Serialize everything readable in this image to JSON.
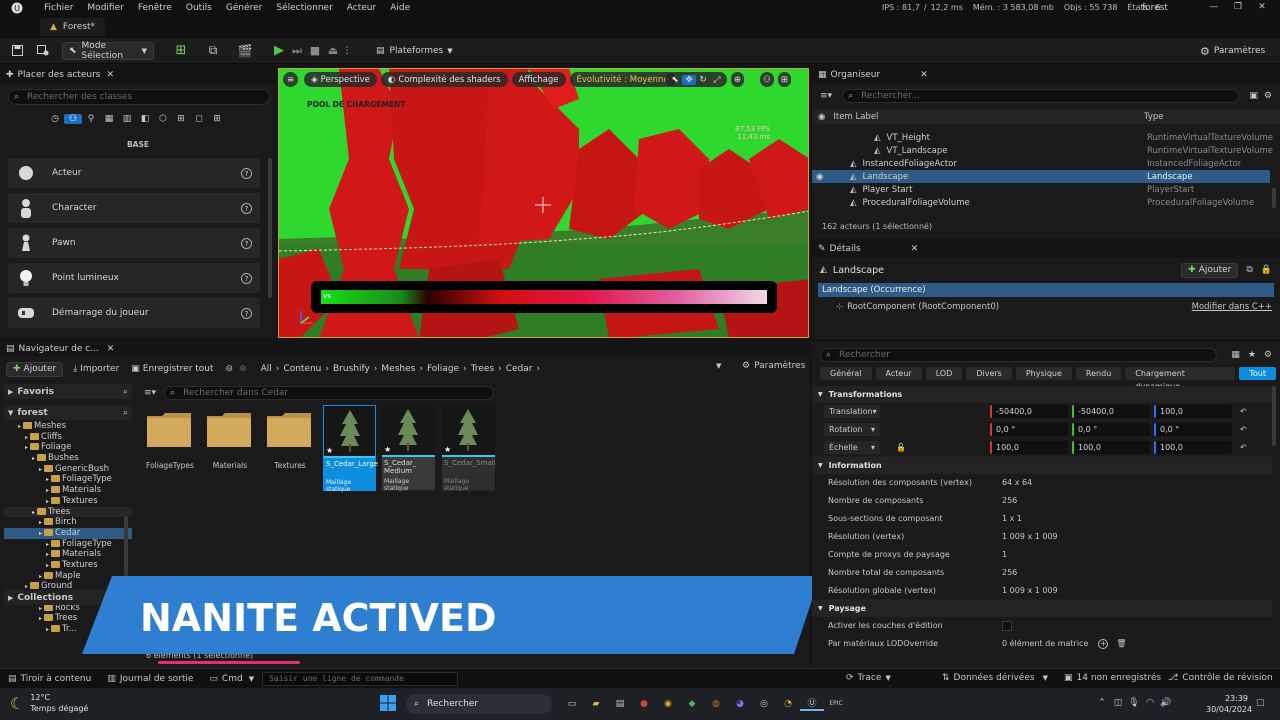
{
  "menu": [
    "Fichier",
    "Modifier",
    "Fenêtre",
    "Outils",
    "Générer",
    "Sélectionner",
    "Acteur",
    "Aide"
  ],
  "window_title": "forest",
  "stats": {
    "fps": "IPS : 81,7",
    "ms": "12,2 ms",
    "mem": "Mém. : 3 583,08 mb",
    "objs": "Objs : 55 738",
    "etats": "États : 6"
  },
  "level_tab": "Forest*",
  "toolbar": {
    "mode": "Mode Sélection",
    "platforms": "Plateformes",
    "settings": "Paramètres"
  },
  "place_actors": {
    "title": "Placer des acteurs",
    "search_placeholder": "Rechercher des classes",
    "category": "BASE",
    "items": [
      "Acteur",
      "Character",
      "Pawn",
      "Point lumineux",
      "Démarrage du joueur"
    ]
  },
  "viewport": {
    "perspective": "Perspective",
    "shader_complexity": "Complexité des shaders",
    "display": "Affichage",
    "scalability": "Évolutivité : Moyenne",
    "overlay_text": "POOL DE CHARGEMENT",
    "fps": "87,53 FPS",
    "ms": "11,43 ms",
    "bar_label": "vs"
  },
  "content_browser": {
    "tab": "Navigateur de c...",
    "add": "Ajouter",
    "import": "Importer",
    "save_all": "Enregistrer tout",
    "settings": "Paramètres",
    "breadcrumb": [
      "All",
      "Contenu",
      "Brushify",
      "Meshes",
      "Foliage",
      "Trees",
      "Cedar"
    ],
    "search_placeholder": "Rechercher dans Cedar",
    "favorites": "Favoris",
    "root": "forest",
    "collections": "Collections",
    "item_count": "6 éléments (1 sélectionné)",
    "tree": [
      {
        "label": "Meshes",
        "depth": 2
      },
      {
        "label": "Cliffs",
        "depth": 3
      },
      {
        "label": "Foliage",
        "depth": 3
      },
      {
        "label": "Bushes",
        "depth": 4
      },
      {
        "label": "GenericBush",
        "depth": 5
      },
      {
        "label": "FoliageType",
        "depth": 6
      },
      {
        "label": "Materials",
        "depth": 6
      },
      {
        "label": "Textures",
        "depth": 6
      },
      {
        "label": "Trees",
        "depth": 4
      },
      {
        "label": "Birch",
        "depth": 5
      },
      {
        "label": "Cedar",
        "depth": 5
      },
      {
        "label": "FoliageType",
        "depth": 6
      },
      {
        "label": "Materials",
        "depth": 6
      },
      {
        "label": "Textures",
        "depth": 6
      },
      {
        "label": "Maple",
        "depth": 5
      },
      {
        "label": "Ground",
        "depth": 3
      },
      {
        "label": "Forest",
        "depth": 4
      },
      {
        "label": "Rocks",
        "depth": 5
      },
      {
        "label": "Trees",
        "depth": 5
      },
      {
        "label": "Tr...",
        "depth": 6
      }
    ],
    "folders": [
      "FoliageTypes",
      "Materials",
      "Textures"
    ],
    "assets": [
      {
        "name": "S_Cedar_Large",
        "type": "Maillage statique"
      },
      {
        "name": "S_Cedar_ Medium",
        "type": "Maillage statique"
      },
      {
        "name": "S_Cedar_Small",
        "type": "Maillage statique"
      }
    ]
  },
  "outliner": {
    "title": "Organiseur",
    "search_placeholder": "Rechercher...",
    "col_label": "Item Label",
    "col_type": "Type",
    "rows": [
      {
        "label": "VT_Height",
        "type": "RuntimeVirtualTextureVolume"
      },
      {
        "label": "VT_Landscape",
        "type": "RuntimeVirtualTextureVolume"
      },
      {
        "label": "InstancedFoliageActor",
        "type": "InstancedFoliageActor"
      },
      {
        "label": "Landscape",
        "type": "Landscape"
      },
      {
        "label": "Player Start",
        "type": "PlayerStart"
      },
      {
        "label": "ProceduralFoliageVolume",
        "type": "ProceduralFoliageVolume"
      }
    ],
    "count": "162 acteurs (1 sélectionné)"
  },
  "details": {
    "title": "Détails",
    "object": "Landscape",
    "add": "Ajouter",
    "instance": "Landscape (Occurrence)",
    "root_component": "RootComponent (RootComponent0)",
    "edit_cpp": "Modifier dans C++",
    "search_placeholder": "Rechercher",
    "tabs": [
      "Général",
      "Acteur",
      "LOD",
      "Divers",
      "Physique",
      "Rendu",
      "Chargement dynamique",
      "Tout"
    ],
    "transforms_header": "Transformations",
    "transforms": [
      {
        "label": "Translation",
        "x": "-50400,0",
        "y": "-50400,0",
        "z": "100,0"
      },
      {
        "label": "Rotation",
        "x": "0,0 °",
        "y": "0,0 °",
        "z": "0,0 °"
      },
      {
        "label": "Échelle",
        "x": "100,0",
        "y": "100,0",
        "z": "100,0"
      }
    ],
    "info_header": "Information",
    "info": [
      {
        "label": "Résolution des composants (vertex)",
        "value": "64 x 64"
      },
      {
        "label": "Nombre de composants",
        "value": "256"
      },
      {
        "label": "Sous-sections de composant",
        "value": "1 x 1"
      },
      {
        "label": "Résolution (vertex)",
        "value": "1 009 x 1 009"
      },
      {
        "label": "Compte de proxys de paysage",
        "value": "1"
      },
      {
        "label": "Nombre total de composants",
        "value": "256"
      },
      {
        "label": "Résolution globale (vertex)",
        "value": "1 009 x 1 009"
      }
    ],
    "landscape_header": "Paysage",
    "landscape_rows": [
      {
        "label": "Activer les couches d'édition",
        "value": ""
      },
      {
        "label": "Par matériaux LODOverride",
        "value": "0 élément de matrice"
      }
    ]
  },
  "statusbar": {
    "drawer": "Tiroir à contenu",
    "log": "Journal de sortie",
    "cmd": "Cmd",
    "cmd_placeholder": "Saisir une ligne de commande",
    "trace": "Trace",
    "derived": "Données dérivées",
    "unsaved": "14 non enregistrés",
    "revision": "Contrôle de révision"
  },
  "taskbar": {
    "weather_temp": "12°C",
    "weather_desc": "Temps dégagé",
    "search": "Rechercher",
    "time": "23:39",
    "date": "30/04/2024"
  },
  "banner_text": "NANITE ACTIVED",
  "colors": {
    "accent": "#0e8ee0",
    "selection": "#2f5a86",
    "banner": "#2e7fd2",
    "viewport_green": "#2fd82f",
    "viewport_red": "#d01818"
  }
}
